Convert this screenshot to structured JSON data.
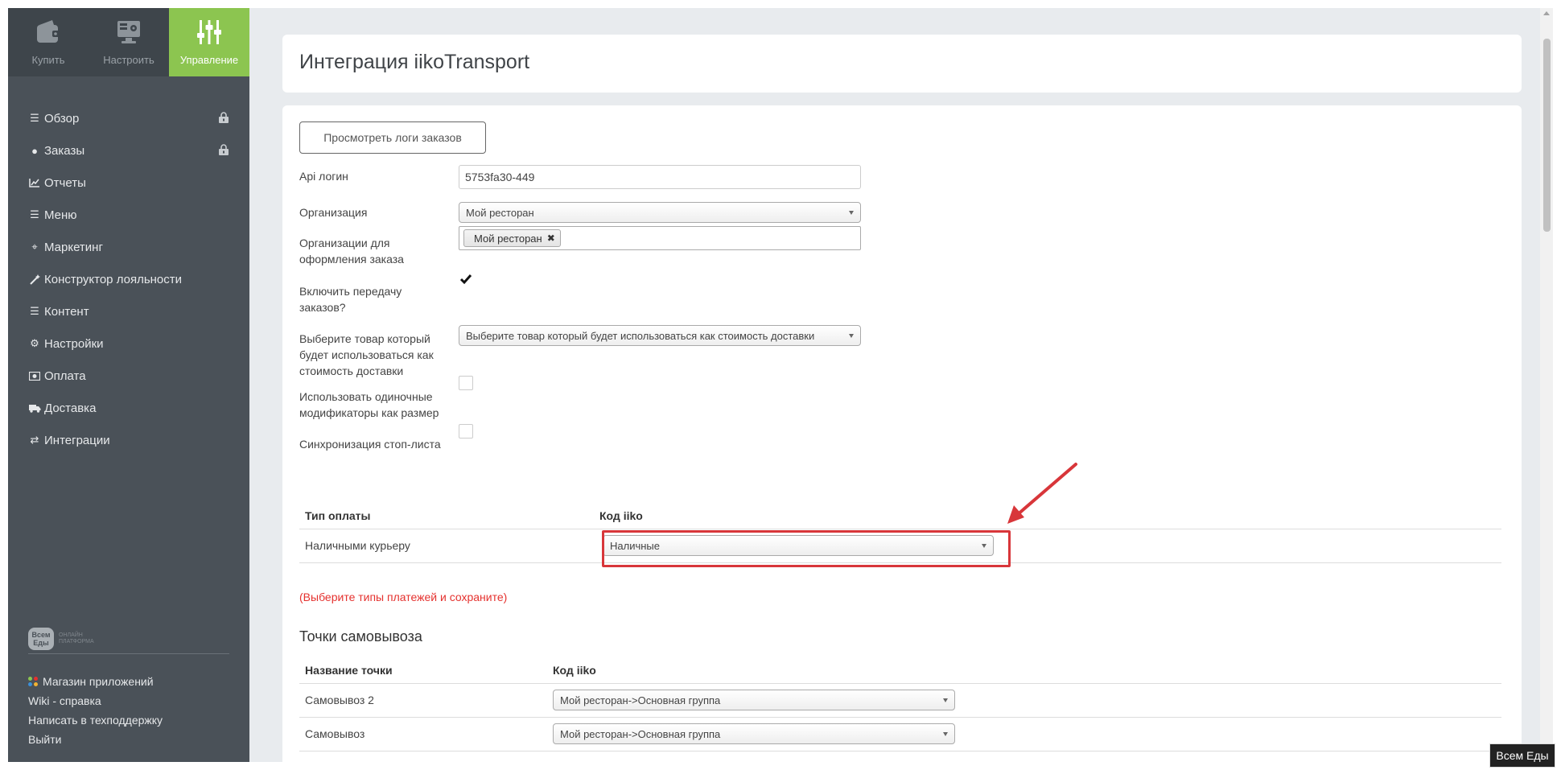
{
  "top_tabs": [
    {
      "label": "Купить",
      "icon": "wallet-icon"
    },
    {
      "label": "Настроить",
      "icon": "monitor-settings-icon"
    },
    {
      "label": "Управление",
      "icon": "sliders-icon"
    }
  ],
  "nav": {
    "items": [
      {
        "label": "Обзор",
        "icon": "list-icon",
        "locked": true
      },
      {
        "label": "Заказы",
        "icon": "circle-icon",
        "locked": true
      },
      {
        "label": "Отчеты",
        "icon": "line-chart-icon"
      },
      {
        "label": "Меню",
        "icon": "list-icon"
      },
      {
        "label": "Маркетинг",
        "icon": "crosshair-icon"
      },
      {
        "label": "Конструктор лояльности",
        "icon": "magic-wand-icon"
      },
      {
        "label": "Контент",
        "icon": "list-icon"
      },
      {
        "label": "Настройки",
        "icon": "gear-icon"
      },
      {
        "label": "Оплата",
        "icon": "money-icon"
      },
      {
        "label": "Доставка",
        "icon": "truck-icon"
      },
      {
        "label": "Интеграции",
        "icon": "exchange-icon"
      }
    ]
  },
  "sidebar_logo": {
    "badge": "Всем Еды",
    "text": "ОНЛАЙН ПЛАТФОРМА"
  },
  "bottom_links": {
    "apps": "Магазин приложений",
    "wiki": "Wiki - справка",
    "support": "Написать в техподдержку",
    "logout": "Выйти"
  },
  "page": {
    "title": "Интеграция iikoTransport"
  },
  "form": {
    "logs_button": "Просмотреть логи заказов",
    "api_login_label": "Api логин",
    "api_login_value": "5753fa30-449",
    "organization_label": "Организация",
    "organization_value": "Мой ресторан",
    "order_orgs_label_1": "Организации для",
    "order_orgs_label_2": "оформления заказа",
    "order_orgs_tag": "Мой ресторан",
    "enable_transfer_label_1": "Включить передачу",
    "enable_transfer_label_2": "заказов?",
    "enable_transfer_checked": true,
    "delivery_product_label_1": "Выберите товар который",
    "delivery_product_label_2": "будет использоваться как",
    "delivery_product_label_3": "стоимость доставки",
    "delivery_product_placeholder": "Выберите товар который будет использоваться как стоимость доставки",
    "single_modifiers_label_1": "Использовать одиночные",
    "single_modifiers_label_2": "модификаторы как размер",
    "single_modifiers_checked": false,
    "stoplist_sync_label": "Синхронизация стоп-листа",
    "stoplist_sync_checked": false
  },
  "payments_table": {
    "col_type": "Тип оплаты",
    "col_code": "Код iiko",
    "rows": [
      {
        "type": "Наличными курьеру",
        "code": "Наличные"
      }
    ]
  },
  "payments_hint": "(Выберите типы платежей и сохраните)",
  "pickup": {
    "title": "Точки самовывоза",
    "col_name": "Название точки",
    "col_code": "Код iiko",
    "rows": [
      {
        "name": "Самовывоз 2",
        "code": "Мой ресторан->Основная группа"
      },
      {
        "name": "Самовывоз",
        "code": "Мой ресторан->Основная группа"
      }
    ]
  },
  "corner_badge": "Всем Еды",
  "colors": {
    "accent": "#8cc550",
    "sidebar": "#4a5158",
    "highlight": "#d8363a",
    "hint": "#e5312e"
  }
}
